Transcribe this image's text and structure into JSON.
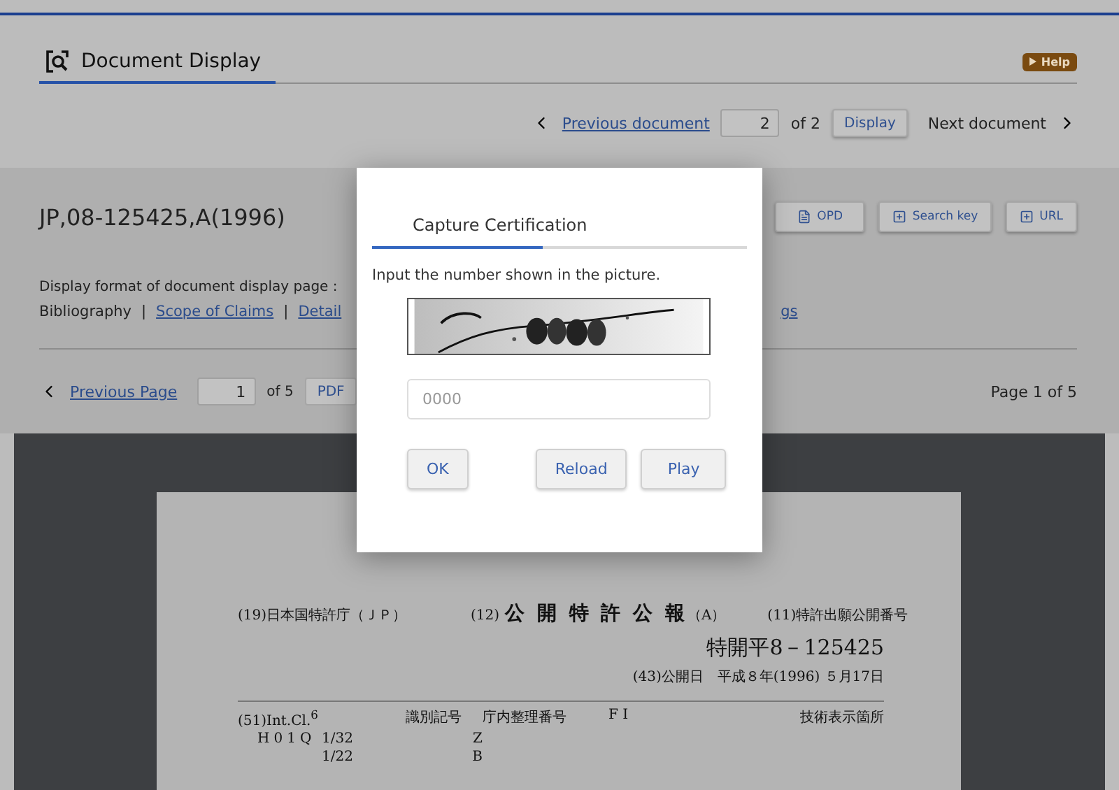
{
  "header": {
    "title": "Document Display",
    "help": "Help"
  },
  "doc_nav": {
    "previous": "Previous document",
    "page": "2",
    "of": "of 2",
    "display": "Display",
    "next": "Next document"
  },
  "document": {
    "id": "JP,08-125425,A(1996)",
    "actions": [
      {
        "label": "OPD",
        "kind": "doc"
      },
      {
        "label": "Search key",
        "kind": "export"
      },
      {
        "label": "URL",
        "kind": "export"
      }
    ],
    "display_format": "Display format of document display page :",
    "views": [
      {
        "label": "Bibliography",
        "kind": "text"
      },
      {
        "label": "|",
        "kind": "separator"
      },
      {
        "label": "Scope of Claims",
        "kind": "link"
      },
      {
        "label": "|",
        "kind": "separator"
      },
      {
        "label": "Detail",
        "kind": "link"
      },
      {
        "label": "gs",
        "kind": "link"
      }
    ]
  },
  "page_nav": {
    "previous": "Previous Page",
    "page": "1",
    "of": "of 5",
    "pdf": "PDF",
    "status": "Page 1 of 5"
  },
  "paper": {
    "office": "(19)日本国特許庁（ＪＰ）",
    "kind_no": "(12)",
    "kind": "公 開 特 許 公 報",
    "kind_suffix": "（A）",
    "pub_label": "(11)特許出願公開番号",
    "pub_number": "特開平8－125425",
    "pub_date": "(43)公開日　平成８年(1996) ５月17日",
    "columns": [
      "(51)Int.Cl.$^{6}$",
      "識別記号",
      "庁内整理番号",
      "F I",
      "技術表示箇所"
    ],
    "rows": [
      [
        "H01Q",
        "1/32",
        "Z"
      ],
      [
        "",
        "1/22",
        "B"
      ]
    ]
  },
  "modal": {
    "tab": "Capture Certification",
    "prompt": "Input the number shown in the picture.",
    "placeholder": "0000",
    "buttons": [
      "OK",
      "Reload",
      "Play"
    ]
  }
}
